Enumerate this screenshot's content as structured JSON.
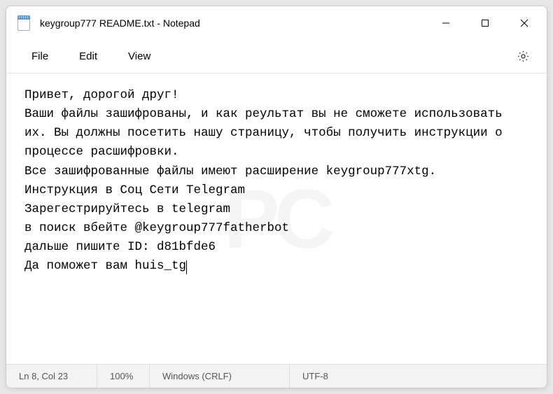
{
  "window": {
    "title": "keygroup777 README.txt - Notepad"
  },
  "menu": {
    "file": "File",
    "edit": "Edit",
    "view": "View"
  },
  "content": {
    "line1": "Привет, дорогой друг!",
    "line2": "Ваши файлы зашифрованы, и как реультат вы не сможете использовать их. Вы должны посетить нашу страницу, чтобы получить инструкции о процессе расшифровки.",
    "line3": "Все зашифрованные файлы имеют расширение keygroup777xtg.",
    "line4": "Инструкция в Соц Сети Telegram",
    "line5": "Зарегестрируйтесь в telegram",
    "line6": "в поиск вбейте @keygroup777fatherbot",
    "line7": "дальше пишите ID: d81bfde6",
    "line8": "Да поможет вам huis_tg"
  },
  "status": {
    "position": "Ln 8, Col 23",
    "zoom": "100%",
    "line_ending": "Windows (CRLF)",
    "encoding": "UTF-8"
  },
  "icons": {
    "minimize": "minimize-icon",
    "maximize": "maximize-icon",
    "close": "close-icon",
    "settings": "gear-icon",
    "app": "notepad-icon"
  }
}
